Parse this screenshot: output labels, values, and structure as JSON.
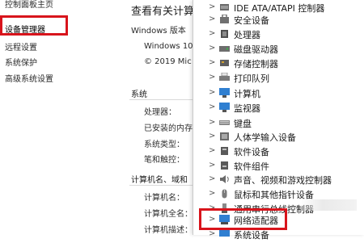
{
  "sidebar": {
    "items": [
      {
        "label": "控制面板主页"
      },
      {
        "label": "设备管理器"
      },
      {
        "label": "远程设置"
      },
      {
        "label": "系统保护"
      },
      {
        "label": "高级系统设置"
      }
    ]
  },
  "main": {
    "heading": "查看有关计算",
    "edition_label": "Windows 版本",
    "edition_value": "Windows 10",
    "copyright": "© 2019 Mic",
    "system_section": "系统",
    "processor_label": "处理器：",
    "ram_label": "已安装的内存",
    "system_type_label": "系统类型：",
    "pen_touch_label": "笔和触控：",
    "computer_section": "计算机名、域和",
    "computer_name_label": "计算机名：",
    "full_name_label": "计算机全名：",
    "description_label": "计算机描述："
  },
  "device_manager": {
    "categories": [
      {
        "label": "IDE ATA/ATAPI 控制器",
        "icon": "ide-controller-icon"
      },
      {
        "label": "安全设备",
        "icon": "security-device-icon"
      },
      {
        "label": "处理器",
        "icon": "processor-icon"
      },
      {
        "label": "磁盘驱动器",
        "icon": "disk-drive-icon"
      },
      {
        "label": "存储控制器",
        "icon": "storage-controller-icon"
      },
      {
        "label": "打印队列",
        "icon": "printer-icon"
      },
      {
        "label": "计算机",
        "icon": "computer-icon"
      },
      {
        "label": "监视器",
        "icon": "monitor-icon"
      },
      {
        "label": "键盘",
        "icon": "keyboard-icon"
      },
      {
        "label": "人体学输入设备",
        "icon": "hid-icon"
      },
      {
        "label": "软件设备",
        "icon": "software-device-icon"
      },
      {
        "label": "软件组件",
        "icon": "software-component-icon"
      },
      {
        "label": "声音、视频和游戏控制器",
        "icon": "sound-icon"
      },
      {
        "label": "鼠标和其他指针设备",
        "icon": "mouse-icon"
      },
      {
        "label": "通用串行总线控制器",
        "icon": "usb-icon"
      },
      {
        "label": "网络适配器",
        "icon": "network-adapter-icon"
      },
      {
        "label": "系统设备",
        "icon": "system-device-icon"
      }
    ]
  },
  "colors": {
    "highlight": "#d8141c",
    "monitor_blue": "#2f7fd1"
  }
}
